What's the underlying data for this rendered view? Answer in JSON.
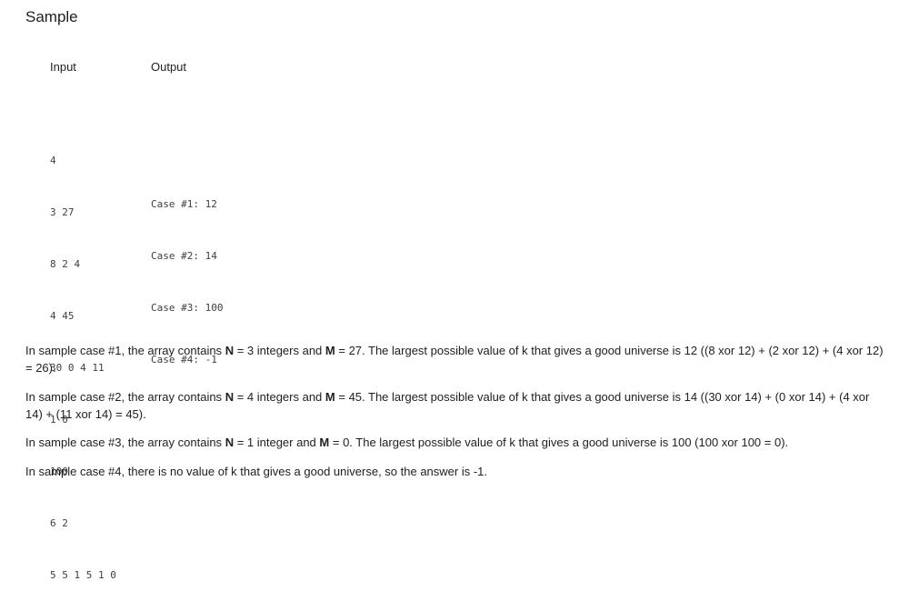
{
  "section_title": "Sample",
  "columns": {
    "input_header": "Input",
    "output_header": "Output"
  },
  "input_lines": [
    "4",
    "3 27",
    "8 2 4",
    "4 45",
    "30 0 4 11",
    "1 0",
    "100",
    "6 2",
    "5 5 1 5 1 0"
  ],
  "output_lines": [
    "Case #1: 12",
    "Case #2: 14",
    "Case #3: 100",
    "Case #4: -1"
  ],
  "explanations": {
    "case1": {
      "t1": "In sample case #1, the array contains ",
      "n": "N",
      "t2": " = 3 integers and ",
      "m": "M",
      "t3": " = 27. The largest possible value of k that gives a good universe is 12 ((8 xor 12) + (2 xor 12) + (4 xor 12) = 26)."
    },
    "case2": {
      "t1": "In sample case #2, the array contains ",
      "n": "N",
      "t2": " = 4 integers and ",
      "m": "M",
      "t3": " = 45. The largest possible value of k that gives a good universe is 14 ((30 xor 14) + (0 xor 14) + (4 xor 14) + (11 xor 14) = 45)."
    },
    "case3": {
      "t1": "In sample case #3, the array contains ",
      "n": "N",
      "t2": " = 1 integer and ",
      "m": "M",
      "t3": " = 0. The largest possible value of k that gives a good universe is 100 (100 xor 100 = 0)."
    },
    "case4": "In sample case #4, there is no value of k that gives a good universe, so the answer is -1."
  }
}
